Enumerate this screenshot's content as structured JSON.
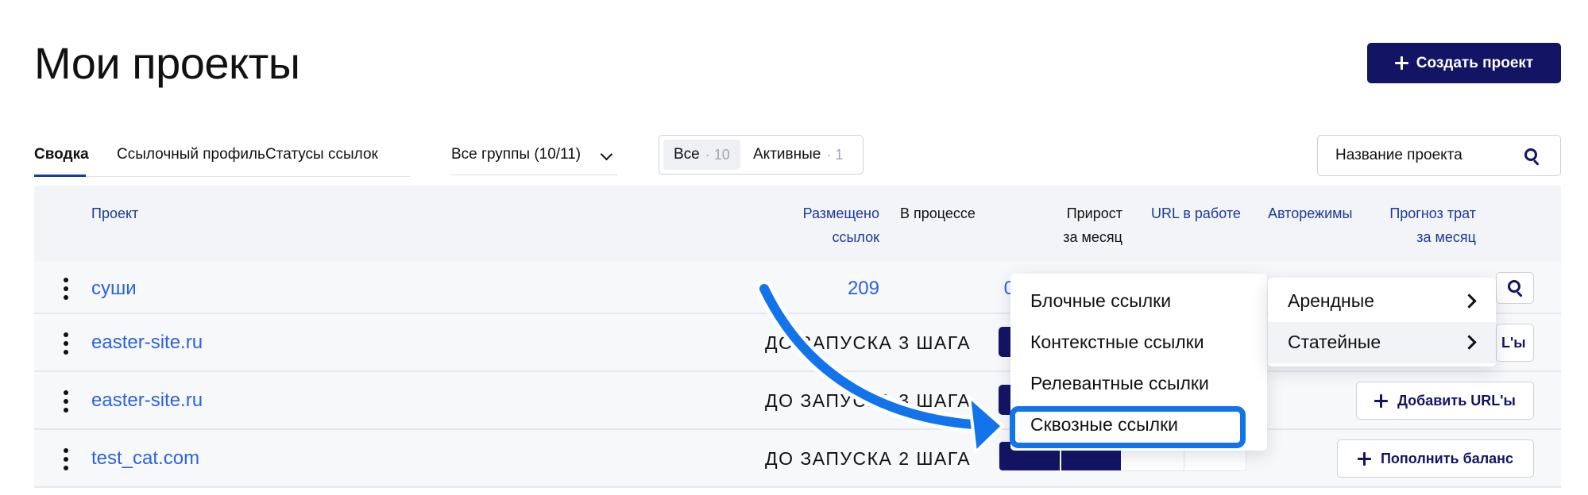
{
  "page": {
    "title": "Мои проекты"
  },
  "actions": {
    "create_label": "Создать проект"
  },
  "tabs": [
    {
      "label": "Сводка",
      "active": true
    },
    {
      "label": "Ссылочный профиль",
      "active": false
    },
    {
      "label": "Статусы ссылок",
      "active": false
    }
  ],
  "groups": {
    "label": "Все группы (10/11)"
  },
  "filter": {
    "all_label": "Все",
    "all_count": "· 10",
    "active_label": "Активные",
    "active_count": "· 1"
  },
  "search": {
    "placeholder": "Название проекта"
  },
  "columns": {
    "project": "Проект",
    "placed_1": "Размещено",
    "placed_2": "ссылок",
    "in_process": "В процессе",
    "growth_1": "Прирост",
    "growth_2": "за месяц",
    "url_work": "URL в работе",
    "automodes": "Авторежимы",
    "forecast_1": "Прогноз трат",
    "forecast_2": "за месяц"
  },
  "rows": [
    {
      "name": "суши",
      "placed": "209",
      "in_process": "0"
    },
    {
      "name": "easter-site.ru",
      "status": "ДО ЗАПУСКА 3 ШАГА",
      "action": "Добавить URL'ы",
      "steps_done": 2,
      "steps_total": 4
    },
    {
      "name": "easter-site.ru",
      "status": "ДО ЗАПУСКА 3 ШАГА",
      "action": "Добавить URL'ы",
      "steps_done": 2,
      "steps_total": 4
    },
    {
      "name": "test_cat.com",
      "status": "ДО ЗАПУСКА 2 ШАГА",
      "action": "Пополнить баланс",
      "steps_done": 2,
      "steps_total": 4
    }
  ],
  "partial_button_text": "L'ы",
  "menu": {
    "items": [
      "Блочные ссылки",
      "Контекстные ссылки",
      "Релевантные ссылки",
      "Сквозные ссылки"
    ],
    "highlighted": "Сквозные ссылки"
  },
  "submenu": {
    "items": [
      "Арендные",
      "Статейные"
    ]
  },
  "colors": {
    "primary": "#141465",
    "link": "#2a63e0",
    "header_text": "#1b3a99",
    "highlight": "#1273eb"
  },
  "icons": {
    "search": "search-icon",
    "kebab": "kebab-menu-icon",
    "plus": "plus-icon",
    "chevron": "chevron-icon"
  }
}
